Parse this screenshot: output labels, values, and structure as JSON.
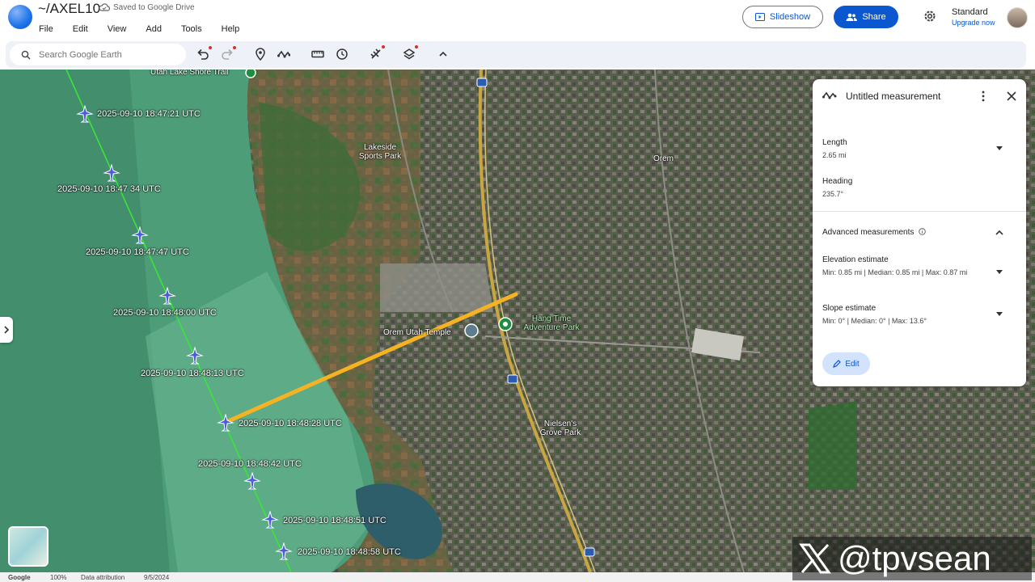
{
  "app": {
    "doc_title": "~/AXEL10",
    "saved_status": "Saved to Google Drive",
    "menu": [
      "File",
      "Edit",
      "View",
      "Add",
      "Tools",
      "Help"
    ],
    "slideshow_label": "Slideshow",
    "share_label": "Share",
    "plan_name": "Standard",
    "upgrade_label": "Upgrade now",
    "accent_color": "#0b57d0"
  },
  "toolbar": {
    "search_placeholder": "Search Google Earth",
    "icons": [
      "undo-icon",
      "redo-icon",
      "placemark-icon",
      "path-icon",
      "ruler-icon",
      "history-icon",
      "satellite-icon",
      "layers-icon",
      "collapse-icon"
    ]
  },
  "map": {
    "timestamps": [
      "2025-09-10 18:47:21 UTC",
      "2025-09-10 18:47 34 UTC",
      "2025-09-10 18:47:47 UTC",
      "2025-09-10 18:48:00 UTC",
      "2025-09-10 18:48:13 UTC",
      "2025-09-10 18:48:28 UTC",
      "2025-09-10 18:48:42 UTC",
      "2025-09-10 18:48:51 UTC",
      "2025-09-10 18:48:58 UTC"
    ],
    "places": {
      "utah_lake_trail": "Utah Lake Shore Trail",
      "lakeside_1": "Lakeside",
      "lakeside_2": "Sports Park",
      "orem": "Orem",
      "temple": "Orem Utah Temple",
      "hangtime_1": "Hang Time",
      "hangtime_2": "Adventure Park",
      "nielsens_1": "Nielsen's",
      "nielsens_2": "Grove Park",
      "highway": "15"
    },
    "track_color": "#4ee04e",
    "measure_color": "#f5b324"
  },
  "measurement_panel": {
    "title": "Untitled measurement",
    "length_label": "Length",
    "length_value": "2.65 mi",
    "heading_label": "Heading",
    "heading_value": "235.7°",
    "advanced_label": "Advanced measurements",
    "elevation_label": "Elevation estimate",
    "elevation_value": "Min: 0.85 mi | Median: 0.85 mi | Max: 0.87 mi",
    "slope_label": "Slope estimate",
    "slope_value": "Min: 0° | Median: 0° | Max: 13.6°",
    "edit_label": "Edit"
  },
  "footer": {
    "brand": "Google",
    "zoom": "100%",
    "attribution": "Data attribution",
    "date": "9/5/2024"
  },
  "watermark": {
    "handle": "@tpvsean"
  }
}
